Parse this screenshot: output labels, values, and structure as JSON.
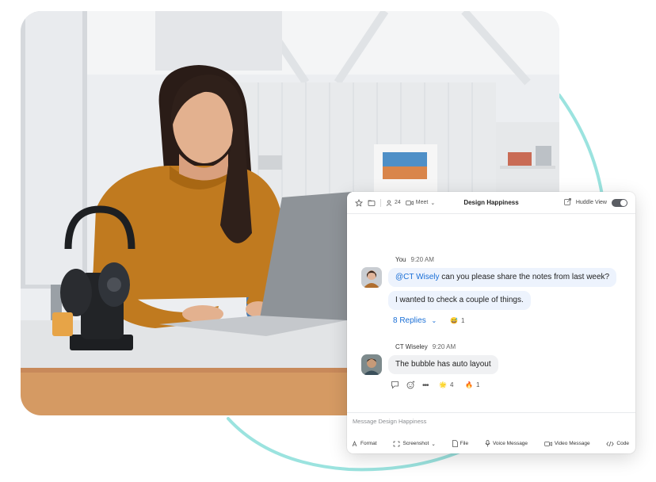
{
  "chat": {
    "header": {
      "member_count": "24",
      "meet_label": "Meet",
      "title": "Design Happiness",
      "huddle_label": "Huddle View"
    },
    "messages": [
      {
        "sender": "You",
        "time": "9:20 AM",
        "lines": [
          {
            "mention": "@CT Wisely",
            "text": " can you please share the notes from last week?"
          },
          {
            "text": "I wanted to check a couple of things."
          }
        ],
        "replies_label": "8 Replies",
        "reactions": [
          {
            "emoji": "😅",
            "count": "1"
          }
        ]
      },
      {
        "sender": "CT Wiseley",
        "time": "9:20 AM",
        "lines": [
          {
            "text": "The bubble has auto layout"
          }
        ],
        "reactions": [
          {
            "emoji": "🌟",
            "count": "4"
          },
          {
            "emoji": "🔥",
            "count": "1"
          }
        ]
      }
    ],
    "composer": {
      "placeholder": "Message Design Happiness",
      "tools": [
        "Format",
        "Screenshot",
        "File",
        "Voice Message",
        "Video Message",
        "Code"
      ]
    }
  },
  "colors": {
    "accent": "#1a6fd6",
    "bubble_blue": "#edf3fd",
    "ring": "#8fe0dc",
    "sweater": "#c07a1f"
  }
}
